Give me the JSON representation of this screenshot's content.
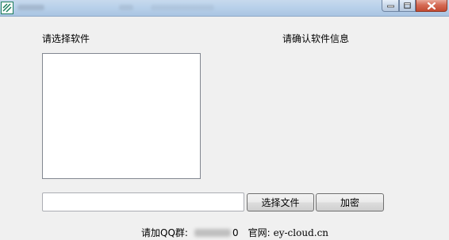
{
  "labels": {
    "select_software": "请选择软件",
    "confirm_info": "请确认软件信息"
  },
  "file_input": {
    "value": "",
    "placeholder": ""
  },
  "buttons": {
    "select_file": "选择文件",
    "encrypt": "加密"
  },
  "footer": {
    "qq_label": "请加QQ群:",
    "qq_visible_tail": "0",
    "website_label": "官网:",
    "website": "ey-cloud.cn"
  },
  "icons": {
    "app": "app-logo-icon",
    "minimize": "minimize-icon",
    "maximize": "maximize-icon",
    "close": "close-icon"
  }
}
